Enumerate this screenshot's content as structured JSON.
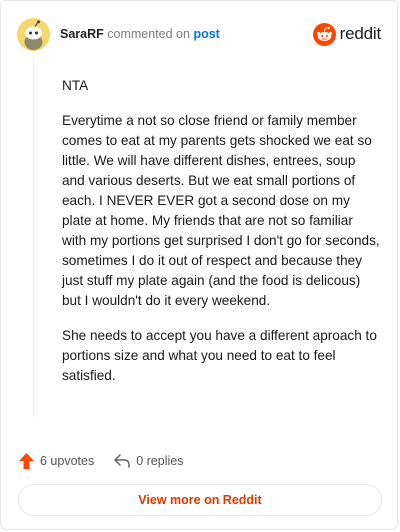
{
  "comment": {
    "username": "SaraRF",
    "action_text": "commented on",
    "post_link": "post",
    "paragraphs": [
      "NTA",
      "Everytime a not so close friend or family member comes to eat at my parents gets shocked we eat so little. We will have different dishes, entrees, soup and various deserts. But we eat small portions of each. I NEVER EVER got a second dose on my plate at home. My friends that are not so familiar with my portions get surprised I don't go for seconds, sometimes I do it out of respect and because they just stuff my plate again (and the food is delicous) but I wouldn't do it every weekend.",
      "She needs to accept you have a different aproach to portions size and what you need to eat to feel satisfied."
    ]
  },
  "brand": {
    "name": "reddit",
    "color": "#ff4500"
  },
  "actions": {
    "upvotes": "6 upvotes",
    "replies": "0 replies"
  },
  "footer": {
    "view_more": "View more on Reddit"
  },
  "colors": {
    "accent": "#d93a00",
    "link": "#0079d3",
    "upvote": "#ff4500"
  }
}
